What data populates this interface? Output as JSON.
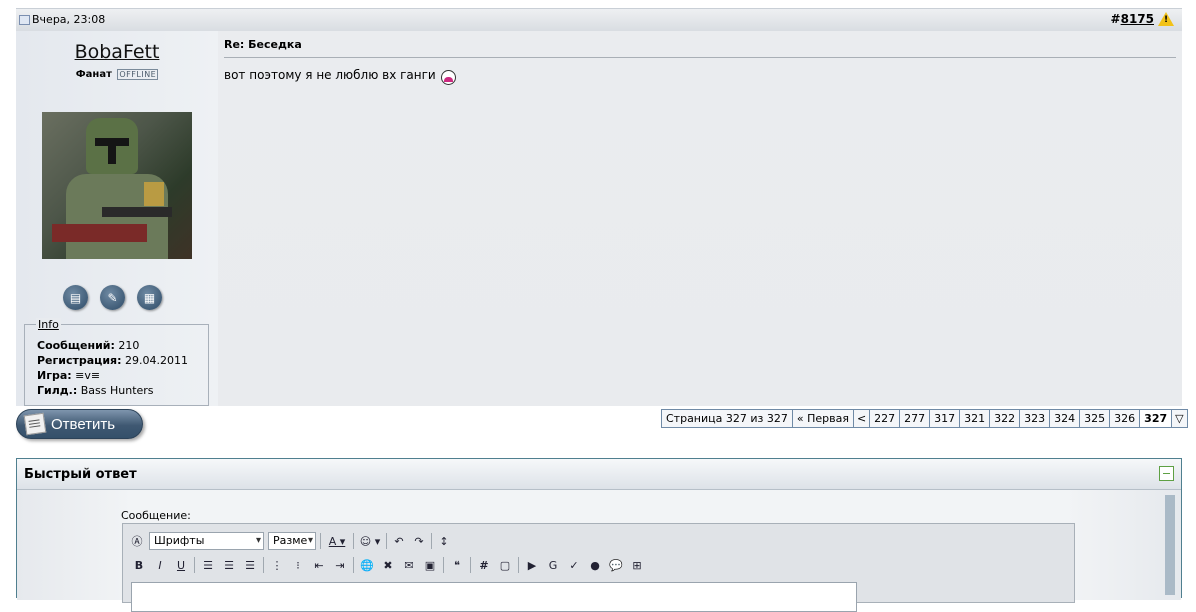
{
  "post": {
    "date": "Вчера, 23:08",
    "number_hash": "#",
    "number": "8175",
    "warning_mark": "!",
    "user": {
      "name": "BobaFett",
      "title": "Фанат",
      "status": "OFFLINE",
      "info_legend": "Info",
      "info": [
        {
          "label": "Сообщений:",
          "value": " 210"
        },
        {
          "label": "Регистрация:",
          "value": " 29.04.2011"
        },
        {
          "label": "Игра:",
          "value": " ≡v≡"
        },
        {
          "label": "Гилд.:",
          "value": " Bass Hunters"
        }
      ]
    },
    "title": "Re: Беседка",
    "text": "вот поэтому я не люблю вх ганги"
  },
  "reply_button": {
    "label": "Ответить"
  },
  "pagenav": {
    "label": "Страница 327 из 327",
    "first": "« Первая",
    "prev": "<",
    "pages": [
      "227",
      "277",
      "317",
      "321",
      "322",
      "323",
      "324",
      "325",
      "326"
    ],
    "current": "327",
    "menu": "▽"
  },
  "quick_reply": {
    "title": "Быстрый ответ",
    "message_label": "Сообщение:",
    "font_select": "Шрифты",
    "size_select": "Разме"
  }
}
